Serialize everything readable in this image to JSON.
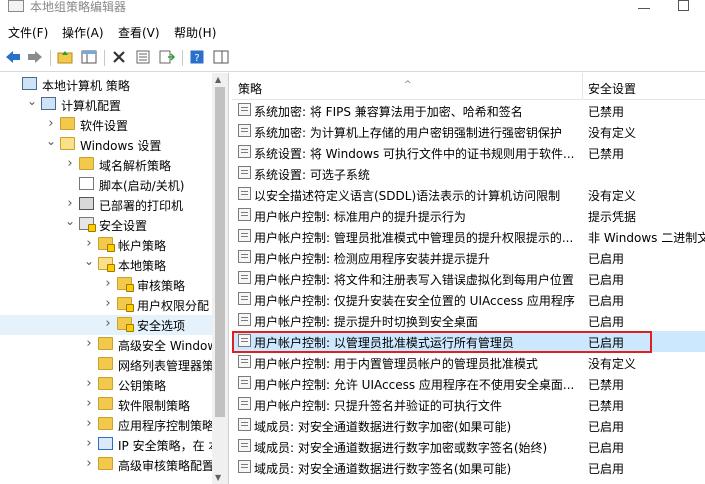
{
  "window": {
    "title": "本地组策略编辑器"
  },
  "menu": [
    {
      "label": "文件(F)"
    },
    {
      "label": "操作(A)"
    },
    {
      "label": "查看(V)"
    },
    {
      "label": "帮助(H)"
    }
  ],
  "toolbar": [
    {
      "icon": "back-arrow-icon"
    },
    {
      "icon": "forward-arrow-icon"
    },
    {
      "icon": "up-folder-icon"
    },
    {
      "icon": "show-hide-tree-icon"
    },
    {
      "icon": "delete-icon"
    },
    {
      "icon": "properties-icon"
    },
    {
      "icon": "export-list-icon"
    },
    {
      "icon": "help-icon"
    },
    {
      "icon": "extended-view-icon"
    }
  ],
  "tree": [
    {
      "label": "本地计算机 策略",
      "indent": 0,
      "arrow": "",
      "icon": "computer"
    },
    {
      "label": "计算机配置",
      "indent": 1,
      "arrow": "down",
      "icon": "computer"
    },
    {
      "label": "软件设置",
      "indent": 2,
      "arrow": "right",
      "icon": "folder"
    },
    {
      "label": "Windows 设置",
      "indent": 2,
      "arrow": "down",
      "icon": "folder-open"
    },
    {
      "label": "域名解析策略",
      "indent": 3,
      "arrow": "right",
      "icon": "folder"
    },
    {
      "label": "脚本(启动/关机)",
      "indent": 3,
      "arrow": "",
      "icon": "script"
    },
    {
      "label": "已部署的打印机",
      "indent": 3,
      "arrow": "right",
      "icon": "printer"
    },
    {
      "label": "安全设置",
      "indent": 3,
      "arrow": "down",
      "icon": "security"
    },
    {
      "label": "帐户策略",
      "indent": 4,
      "arrow": "right",
      "icon": "folder-lock"
    },
    {
      "label": "本地策略",
      "indent": 4,
      "arrow": "down",
      "icon": "folder-lock-open"
    },
    {
      "label": "审核策略",
      "indent": 5,
      "arrow": "right",
      "icon": "folder-lock"
    },
    {
      "label": "用户权限分配",
      "indent": 5,
      "arrow": "right",
      "icon": "folder-lock"
    },
    {
      "label": "安全选项",
      "indent": 5,
      "arrow": "right",
      "icon": "folder-lock",
      "selected": true
    },
    {
      "label": "高级安全 Windows",
      "indent": 4,
      "arrow": "right",
      "icon": "folder"
    },
    {
      "label": "网络列表管理器策略",
      "indent": 4,
      "arrow": "",
      "icon": "folder"
    },
    {
      "label": "公钥策略",
      "indent": 4,
      "arrow": "right",
      "icon": "folder"
    },
    {
      "label": "软件限制策略",
      "indent": 4,
      "arrow": "right",
      "icon": "folder"
    },
    {
      "label": "应用程序控制策略",
      "indent": 4,
      "arrow": "right",
      "icon": "folder"
    },
    {
      "label": "IP 安全策略，在 本地",
      "indent": 4,
      "arrow": "right",
      "icon": "ipsec"
    },
    {
      "label": "高级审核策略配置",
      "indent": 4,
      "arrow": "right",
      "icon": "folder"
    }
  ],
  "list": {
    "headers": {
      "policy": "策略",
      "setting": "安全设置"
    },
    "rows": [
      {
        "policy": "系统加密: 将 FIPS 兼容算法用于加密、哈希和签名",
        "setting": "已禁用"
      },
      {
        "policy": "系统加密: 为计算机上存储的用户密钥强制进行强密钥保护",
        "setting": "没有定义"
      },
      {
        "policy": "系统设置: 将 Windows 可执行文件中的证书规则用于软件...",
        "setting": "已禁用"
      },
      {
        "policy": "系统设置: 可选子系统",
        "setting": ""
      },
      {
        "policy": "以安全描述符定义语言(SDDL)语法表示的计算机访问限制",
        "setting": "没有定义"
      },
      {
        "policy": "用户帐户控制: 标准用户的提升提示行为",
        "setting": "提示凭据"
      },
      {
        "policy": "用户帐户控制: 管理员批准模式中管理员的提升权限提示的...",
        "setting": "非 Windows 二进制文件"
      },
      {
        "policy": "用户帐户控制: 检测应用程序安装并提示提升",
        "setting": "已启用"
      },
      {
        "policy": "用户帐户控制: 将文件和注册表写入错误虚拟化到每用户位置",
        "setting": "已启用"
      },
      {
        "policy": "用户帐户控制: 仅提升安装在安全位置的 UIAccess 应用程序",
        "setting": "已启用"
      },
      {
        "policy": "用户帐户控制: 提示提升时切换到安全桌面",
        "setting": "已启用"
      },
      {
        "policy": "用户帐户控制: 以管理员批准模式运行所有管理员",
        "setting": "已启用",
        "highlighted": true
      },
      {
        "policy": "用户帐户控制: 用于内置管理员帐户的管理员批准模式",
        "setting": "没有定义"
      },
      {
        "policy": "用户帐户控制: 允许 UIAccess 应用程序在不使用安全桌面...",
        "setting": "已禁用"
      },
      {
        "policy": "用户帐户控制: 只提升签名并验证的可执行文件",
        "setting": "已禁用"
      },
      {
        "policy": "域成员: 对安全通道数据进行数字加密(如果可能)",
        "setting": "已启用"
      },
      {
        "policy": "域成员: 对安全通道数据进行数字加密或数字签名(始终)",
        "setting": "已启用"
      },
      {
        "policy": "域成员: 对安全通道数据进行数字签名(如果可能)",
        "setting": "已启用"
      }
    ]
  }
}
